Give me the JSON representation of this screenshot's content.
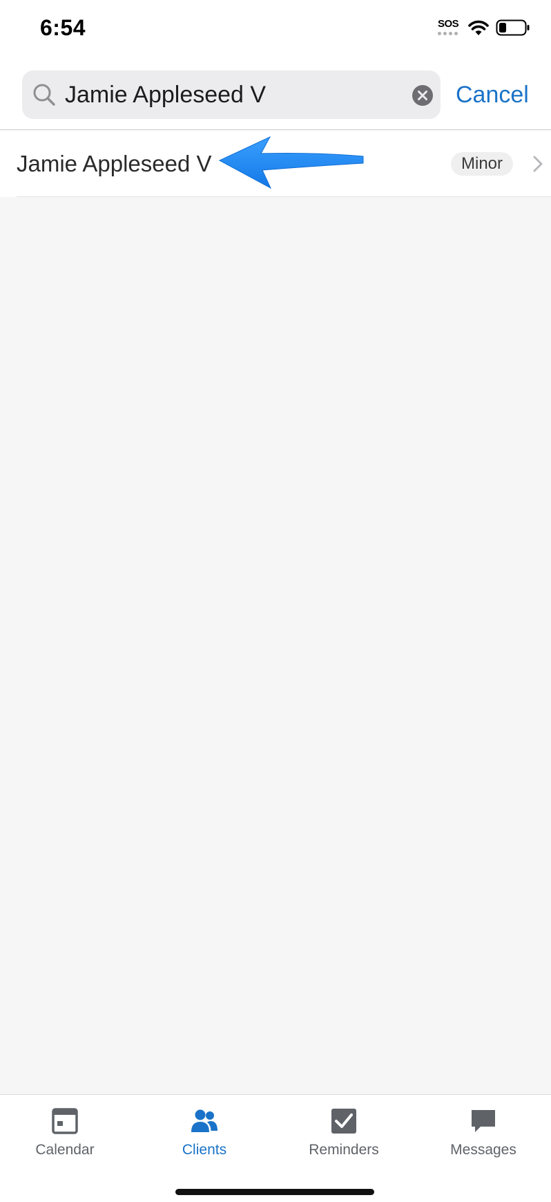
{
  "status_bar": {
    "time": "6:54",
    "sos_label": "SOS",
    "icons": [
      "sos-icon",
      "wifi-icon",
      "battery-icon"
    ]
  },
  "search": {
    "value": "Jamie Appleseed V",
    "cancel_label": "Cancel",
    "icons": [
      "search-icon",
      "clear-icon"
    ]
  },
  "results": [
    {
      "name": "Jamie Appleseed V",
      "badge": "Minor"
    }
  ],
  "tabs": [
    {
      "label": "Calendar",
      "icon": "calendar-icon",
      "active": false
    },
    {
      "label": "Clients",
      "icon": "clients-icon",
      "active": true
    },
    {
      "label": "Reminders",
      "icon": "reminders-icon",
      "active": false
    },
    {
      "label": "Messages",
      "icon": "messages-icon",
      "active": false
    }
  ],
  "colors": {
    "accent": "#1a73c8",
    "annotation_arrow": "#1e90ff",
    "background": "#f6f6f6",
    "inactive_tab": "#5f6368"
  }
}
